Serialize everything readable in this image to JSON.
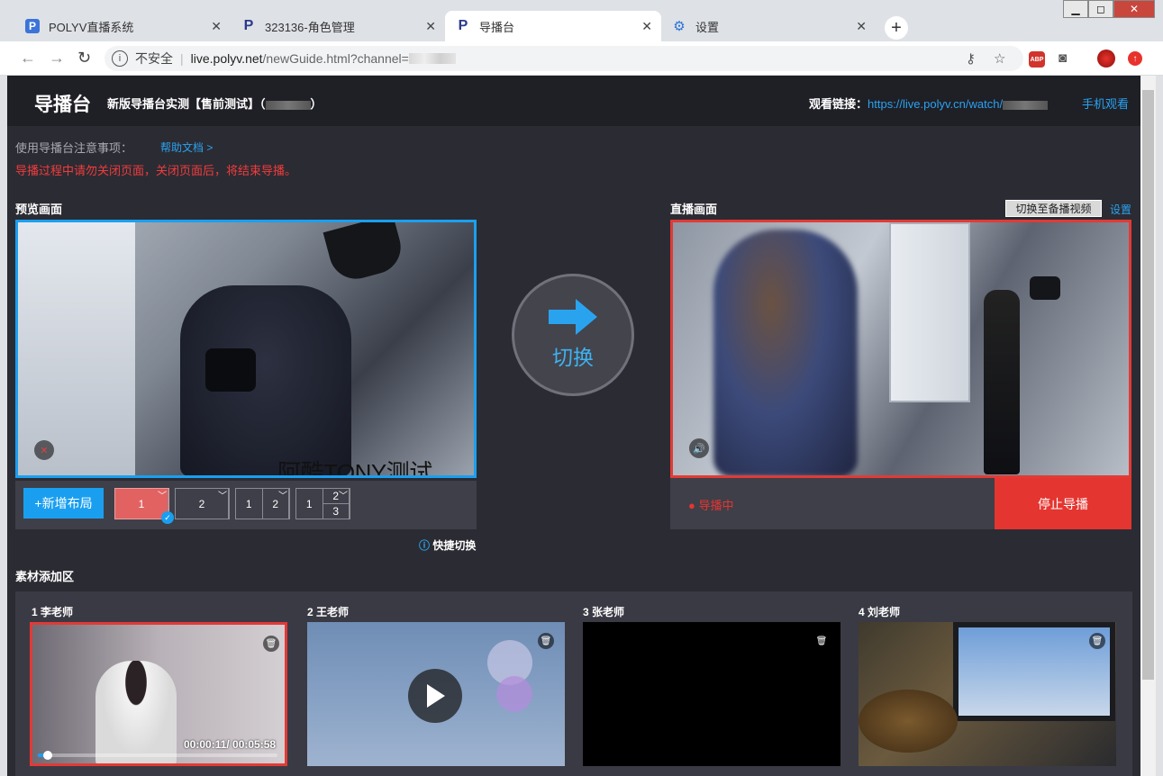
{
  "browser": {
    "tabs": [
      {
        "title": "POLYV直播系统",
        "icon": "polyv-p-icon"
      },
      {
        "title": "323136-角色管理",
        "icon": "polyv-p-icon"
      },
      {
        "title": "导播台",
        "icon": "polyv-p-icon",
        "active": true
      },
      {
        "title": "设置",
        "icon": "gear-icon"
      }
    ],
    "tab_close": "✕",
    "new_tab": "+",
    "security_label": "不安全",
    "url_host": "live.polyv.net",
    "url_path": "/newGuide.html?channel="
  },
  "header": {
    "title": "导播台",
    "subtitle_prefix": "新版导播台实测【售前测试】（",
    "subtitle_suffix": "）",
    "watch_label": "观看链接：",
    "watch_url": "https://live.polyv.cn/watch/",
    "mobile_watch": "手机观看"
  },
  "notice": {
    "label": "使用导播台注意事项：",
    "help_link": "帮助文档 >",
    "warning": "导播过程中请勿关闭页面，关闭页面后，将结束导播。"
  },
  "preview": {
    "label": "预览画面",
    "watermark": "阿酷TONY测试"
  },
  "live": {
    "label": "直播画面",
    "backup_button": "切换至备播视频",
    "settings_link": "设置",
    "status": "导播中",
    "stop_button": "停止导播"
  },
  "switch": {
    "label": "切换"
  },
  "layouts": {
    "add_button": "+新增布局",
    "options": [
      {
        "cells": [
          "1"
        ]
      },
      {
        "cells": [
          "2"
        ]
      },
      {
        "cells": [
          "1",
          "2"
        ]
      },
      {
        "cells": [
          "1",
          "2",
          "3"
        ]
      }
    ],
    "quick_switch": "快捷切换"
  },
  "materials": {
    "label": "素材添加区",
    "items": [
      {
        "label": "1 李老师",
        "time": "00:00:11/ 00:05:58",
        "progress": 0.03
      },
      {
        "label": "2 王老师"
      },
      {
        "label": "3 张老师"
      },
      {
        "label": "4 刘老师"
      }
    ]
  },
  "colors": {
    "accent_blue": "#1a9ff0",
    "live_red": "#e53530",
    "page_bg": "#2b2b33"
  }
}
